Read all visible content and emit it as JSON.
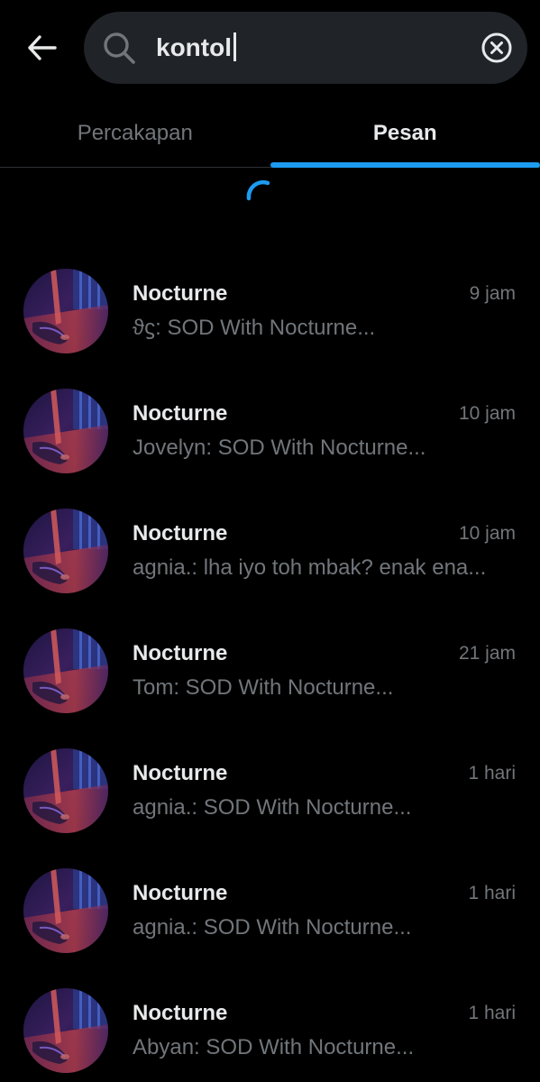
{
  "header": {
    "back_icon": "arrow-left-icon",
    "search": {
      "value": "kontol",
      "search_icon": "search-icon",
      "clear_icon": "clear-circle-x-icon"
    }
  },
  "tabs": [
    {
      "label": "Percakapan",
      "active": false
    },
    {
      "label": "Pesan",
      "active": true
    }
  ],
  "colors": {
    "accent": "#1d9bf0",
    "background": "#000000",
    "search_bg": "#202327",
    "primary_text": "#e7e9ea",
    "secondary_text": "#71767b"
  },
  "loading_indicator": "spinner",
  "messages": [
    {
      "name": "Nocturne",
      "time": "9 jam",
      "preview": "ϑϛ: SOD With Nocturne..."
    },
    {
      "name": "Nocturne",
      "time": "10 jam",
      "preview": "Jovelyn: SOD With Nocturne..."
    },
    {
      "name": "Nocturne",
      "time": "10 jam",
      "preview": "agnia.: lha iyo toh mbak? enak ena..."
    },
    {
      "name": "Nocturne",
      "time": "21 jam",
      "preview": "Tom: SOD With Nocturne..."
    },
    {
      "name": "Nocturne",
      "time": "1 hari",
      "preview": "agnia.: SOD With Nocturne..."
    },
    {
      "name": "Nocturne",
      "time": "1 hari",
      "preview": "agnia.: SOD With Nocturne..."
    },
    {
      "name": "Nocturne",
      "time": "1 hari",
      "preview": "Abyan: SOD With Nocturne..."
    }
  ]
}
